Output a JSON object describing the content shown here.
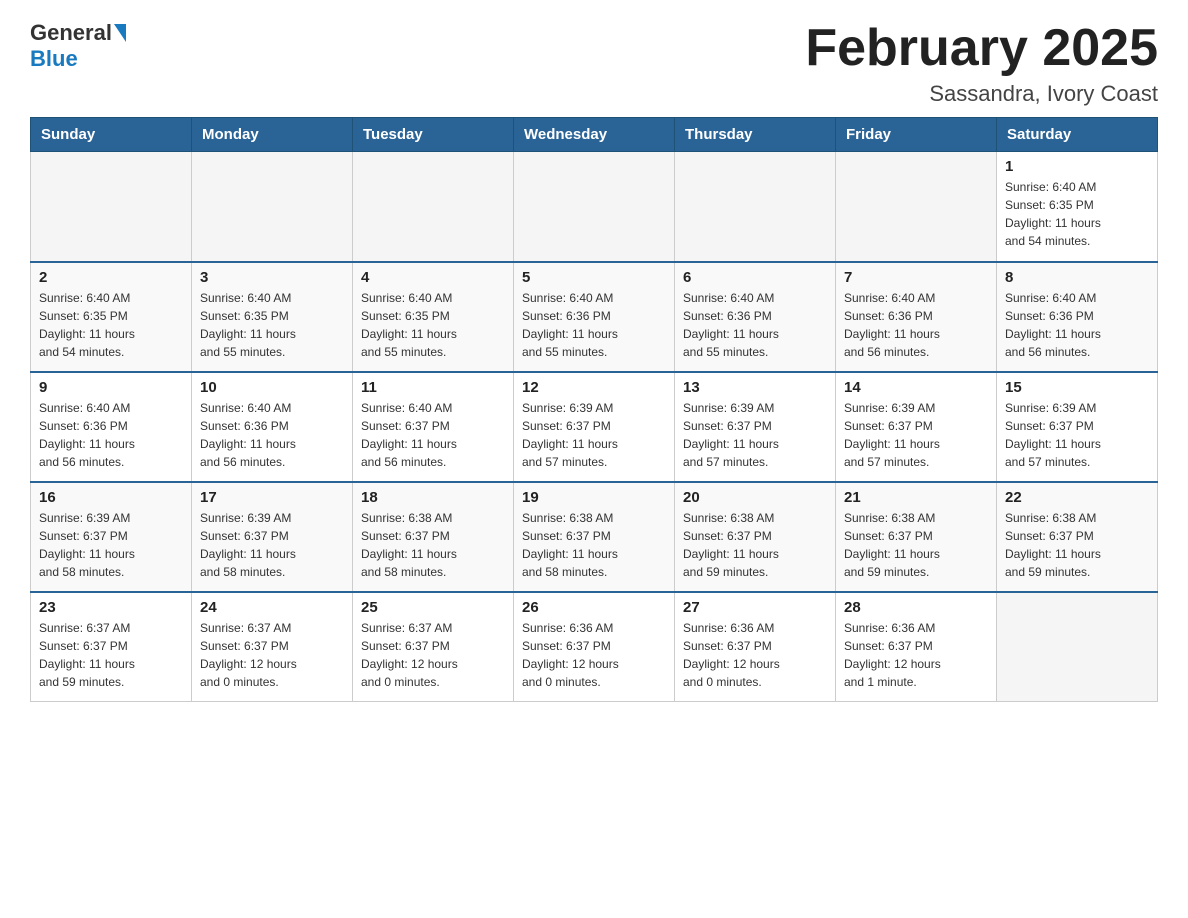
{
  "header": {
    "logo_general": "General",
    "logo_blue": "Blue",
    "month_title": "February 2025",
    "location": "Sassandra, Ivory Coast"
  },
  "days_of_week": [
    "Sunday",
    "Monday",
    "Tuesday",
    "Wednesday",
    "Thursday",
    "Friday",
    "Saturday"
  ],
  "weeks": [
    [
      {
        "day": "",
        "info": ""
      },
      {
        "day": "",
        "info": ""
      },
      {
        "day": "",
        "info": ""
      },
      {
        "day": "",
        "info": ""
      },
      {
        "day": "",
        "info": ""
      },
      {
        "day": "",
        "info": ""
      },
      {
        "day": "1",
        "info": "Sunrise: 6:40 AM\nSunset: 6:35 PM\nDaylight: 11 hours\nand 54 minutes."
      }
    ],
    [
      {
        "day": "2",
        "info": "Sunrise: 6:40 AM\nSunset: 6:35 PM\nDaylight: 11 hours\nand 54 minutes."
      },
      {
        "day": "3",
        "info": "Sunrise: 6:40 AM\nSunset: 6:35 PM\nDaylight: 11 hours\nand 55 minutes."
      },
      {
        "day": "4",
        "info": "Sunrise: 6:40 AM\nSunset: 6:35 PM\nDaylight: 11 hours\nand 55 minutes."
      },
      {
        "day": "5",
        "info": "Sunrise: 6:40 AM\nSunset: 6:36 PM\nDaylight: 11 hours\nand 55 minutes."
      },
      {
        "day": "6",
        "info": "Sunrise: 6:40 AM\nSunset: 6:36 PM\nDaylight: 11 hours\nand 55 minutes."
      },
      {
        "day": "7",
        "info": "Sunrise: 6:40 AM\nSunset: 6:36 PM\nDaylight: 11 hours\nand 56 minutes."
      },
      {
        "day": "8",
        "info": "Sunrise: 6:40 AM\nSunset: 6:36 PM\nDaylight: 11 hours\nand 56 minutes."
      }
    ],
    [
      {
        "day": "9",
        "info": "Sunrise: 6:40 AM\nSunset: 6:36 PM\nDaylight: 11 hours\nand 56 minutes."
      },
      {
        "day": "10",
        "info": "Sunrise: 6:40 AM\nSunset: 6:36 PM\nDaylight: 11 hours\nand 56 minutes."
      },
      {
        "day": "11",
        "info": "Sunrise: 6:40 AM\nSunset: 6:37 PM\nDaylight: 11 hours\nand 56 minutes."
      },
      {
        "day": "12",
        "info": "Sunrise: 6:39 AM\nSunset: 6:37 PM\nDaylight: 11 hours\nand 57 minutes."
      },
      {
        "day": "13",
        "info": "Sunrise: 6:39 AM\nSunset: 6:37 PM\nDaylight: 11 hours\nand 57 minutes."
      },
      {
        "day": "14",
        "info": "Sunrise: 6:39 AM\nSunset: 6:37 PM\nDaylight: 11 hours\nand 57 minutes."
      },
      {
        "day": "15",
        "info": "Sunrise: 6:39 AM\nSunset: 6:37 PM\nDaylight: 11 hours\nand 57 minutes."
      }
    ],
    [
      {
        "day": "16",
        "info": "Sunrise: 6:39 AM\nSunset: 6:37 PM\nDaylight: 11 hours\nand 58 minutes."
      },
      {
        "day": "17",
        "info": "Sunrise: 6:39 AM\nSunset: 6:37 PM\nDaylight: 11 hours\nand 58 minutes."
      },
      {
        "day": "18",
        "info": "Sunrise: 6:38 AM\nSunset: 6:37 PM\nDaylight: 11 hours\nand 58 minutes."
      },
      {
        "day": "19",
        "info": "Sunrise: 6:38 AM\nSunset: 6:37 PM\nDaylight: 11 hours\nand 58 minutes."
      },
      {
        "day": "20",
        "info": "Sunrise: 6:38 AM\nSunset: 6:37 PM\nDaylight: 11 hours\nand 59 minutes."
      },
      {
        "day": "21",
        "info": "Sunrise: 6:38 AM\nSunset: 6:37 PM\nDaylight: 11 hours\nand 59 minutes."
      },
      {
        "day": "22",
        "info": "Sunrise: 6:38 AM\nSunset: 6:37 PM\nDaylight: 11 hours\nand 59 minutes."
      }
    ],
    [
      {
        "day": "23",
        "info": "Sunrise: 6:37 AM\nSunset: 6:37 PM\nDaylight: 11 hours\nand 59 minutes."
      },
      {
        "day": "24",
        "info": "Sunrise: 6:37 AM\nSunset: 6:37 PM\nDaylight: 12 hours\nand 0 minutes."
      },
      {
        "day": "25",
        "info": "Sunrise: 6:37 AM\nSunset: 6:37 PM\nDaylight: 12 hours\nand 0 minutes."
      },
      {
        "day": "26",
        "info": "Sunrise: 6:36 AM\nSunset: 6:37 PM\nDaylight: 12 hours\nand 0 minutes."
      },
      {
        "day": "27",
        "info": "Sunrise: 6:36 AM\nSunset: 6:37 PM\nDaylight: 12 hours\nand 0 minutes."
      },
      {
        "day": "28",
        "info": "Sunrise: 6:36 AM\nSunset: 6:37 PM\nDaylight: 12 hours\nand 1 minute."
      },
      {
        "day": "",
        "info": ""
      }
    ]
  ]
}
